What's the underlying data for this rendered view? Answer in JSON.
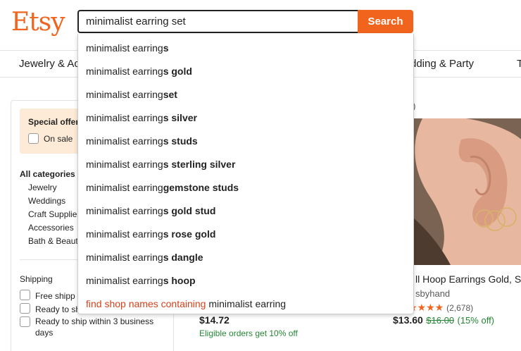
{
  "header": {
    "logo": "Etsy",
    "search_value": "minimalist earring set",
    "search_button": "Search"
  },
  "catnav": {
    "items": [
      "Jewelry & Ac",
      "dding & Party",
      "T"
    ]
  },
  "sidebar": {
    "special_offers_title": "Special offer",
    "on_sale_label": "On sale",
    "all_categories_title": "All categories",
    "categories": [
      "Jewelry",
      "Weddings",
      "Craft Supplie",
      "Accessories",
      "Bath & Beaut"
    ],
    "shipping_title": "Shipping",
    "shipping_options": [
      "Free shipp",
      "Ready to sh",
      "Ready to ship within 3 business",
      "days"
    ]
  },
  "main": {
    "results_fragment": "ts)",
    "left_price": "$14.72",
    "left_promo": "Eligible orders get 10% off",
    "right_title": "ll Hoop Earrings Gold, S",
    "right_shop": "sbyhand",
    "right_stars": "★★★★",
    "right_reviews": "(2,678)",
    "right_price": "$13.60",
    "right_old_price": "$16.00",
    "right_discount": "(15% off)"
  },
  "suggestions": [
    {
      "base": "minimalist earring",
      "bold": "s"
    },
    {
      "base": "minimalist earring",
      "bold": "s gold"
    },
    {
      "base": "minimalist earring ",
      "bold": "set"
    },
    {
      "base": "minimalist earring",
      "bold": "s silver"
    },
    {
      "base": "minimalist earring",
      "bold": "s studs"
    },
    {
      "base": "minimalist earring",
      "bold": "s sterling silver"
    },
    {
      "base": "minimalist earring ",
      "bold": "gemstone studs"
    },
    {
      "base": "minimalist earring",
      "bold": "s gold stud"
    },
    {
      "base": "minimalist earring",
      "bold": "s rose gold"
    },
    {
      "base": "minimalist earring",
      "bold": "s dangle"
    },
    {
      "base": "minimalist earring",
      "bold": "s hoop"
    }
  ],
  "shop_suggestion": {
    "prefix": "find shop names containing",
    "query": "minimalist earring"
  },
  "colors": {
    "brand": "#F1641E",
    "star": "#F1641E",
    "promo_green": "#258635",
    "shop_link_red": "#D5421A",
    "special_bg": "#FDEBD7"
  },
  "icons": {
    "star": "star-icon"
  }
}
